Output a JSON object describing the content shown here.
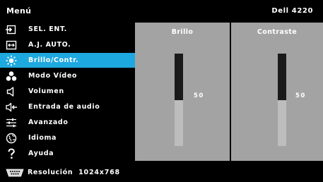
{
  "header": {
    "title": "Menú",
    "model": "Dell 4220"
  },
  "sidebar": {
    "selected_index": 2,
    "items": [
      {
        "label": "SEL. ENT.",
        "icon": "input-source-icon"
      },
      {
        "label": "A.J. AUTO.",
        "icon": "auto-adjust-icon"
      },
      {
        "label": "Brillo/Contr.",
        "icon": "brightness-icon"
      },
      {
        "label": "Modo Vídeo",
        "icon": "video-mode-icon"
      },
      {
        "label": "Volumen",
        "icon": "speaker-icon"
      },
      {
        "label": "Entrada de audio",
        "icon": "audio-input-icon"
      },
      {
        "label": "Avanzado",
        "icon": "sliders-icon"
      },
      {
        "label": "Idioma",
        "icon": "globe-icon"
      },
      {
        "label": "Ayuda",
        "icon": "question-mark-icon"
      }
    ]
  },
  "brightness": {
    "title": "Brillo",
    "value": "50",
    "level_percent": 50
  },
  "contrast": {
    "title": "Contraste",
    "value": "50",
    "level_percent": 50
  },
  "footer": {
    "icon": "vga-connector-icon",
    "label": "Resolución",
    "value": "1024x768"
  },
  "colors": {
    "background": "#000000",
    "selected": "#1ea8e0",
    "panel": "#a3a3a3",
    "bar_track": "#1a1a1a",
    "bar_fill": "#bdbdbd"
  }
}
